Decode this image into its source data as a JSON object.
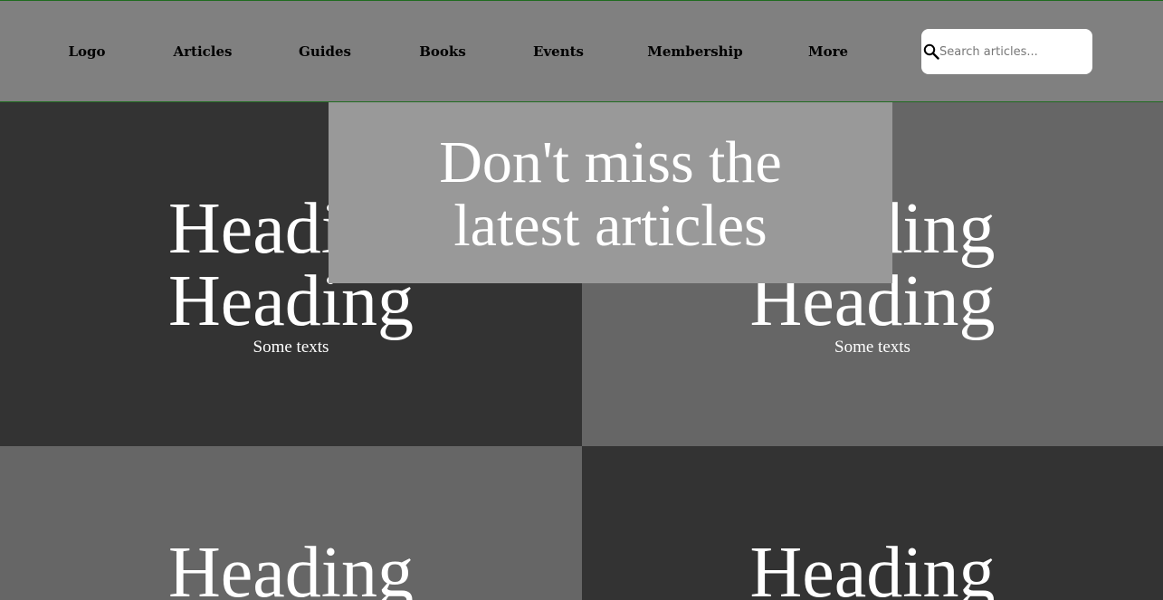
{
  "nav": {
    "items": [
      {
        "label": "Logo"
      },
      {
        "label": "Articles"
      },
      {
        "label": "Guides"
      },
      {
        "label": "Books"
      },
      {
        "label": "Events"
      },
      {
        "label": "Membership"
      },
      {
        "label": "More"
      }
    ],
    "search": {
      "placeholder": "Search articles...",
      "value": "",
      "icon": "search-icon"
    }
  },
  "banner": {
    "line1": "Don't miss the",
    "line2": "latest articles"
  },
  "tiles": [
    {
      "heading_line1": "Heading",
      "heading_line2": "Heading",
      "text": "Some texts",
      "color": "#333333"
    },
    {
      "heading_line1": "Heading",
      "heading_line2": "Heading",
      "text": "Some texts",
      "color": "#666666"
    },
    {
      "heading_line1": "Heading",
      "color": "#666666"
    },
    {
      "heading_line1": "Heading",
      "color": "#333333"
    }
  ],
  "colors": {
    "nav_bg": "#808080",
    "nav_border": "#1f6b1f",
    "banner_bg": "#999999",
    "text": "#ffffff"
  }
}
